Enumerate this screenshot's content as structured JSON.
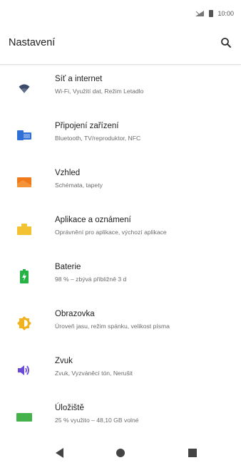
{
  "status": {
    "time": "10:00"
  },
  "header": {
    "title": "Nastavení"
  },
  "items": [
    {
      "title": "Síť a internet",
      "subtitle": "Wi-Fi, Využití dat, Režim Letadlo"
    },
    {
      "title": "Připojení zařízení",
      "subtitle": "Bluetooth, TV/reproduktor, NFC"
    },
    {
      "title": "Vzhled",
      "subtitle": "Schémata, tapety"
    },
    {
      "title": "Aplikace a oznámení",
      "subtitle": "Oprávnění pro aplikace, výchozí aplikace"
    },
    {
      "title": "Baterie",
      "subtitle": "98 % – zbývá přibližně 3 d"
    },
    {
      "title": "Obrazovka",
      "subtitle": "Úroveň jasu, režim spánku, velikost písma"
    },
    {
      "title": "Zvuk",
      "subtitle": "Zvuk, Vyzváněcí tón, Nerušit"
    },
    {
      "title": "Úložiště",
      "subtitle": "25 % využito – 48,10 GB volné"
    }
  ],
  "icons": {
    "wifi": "wifi-icon",
    "devices": "devices-icon",
    "appearance": "appearance-icon",
    "apps": "apps-icon",
    "battery": "battery-icon",
    "display": "display-icon",
    "sound": "sound-icon",
    "storage": "storage-icon"
  },
  "colors": {
    "wifi": "#3b4c6b",
    "devices": "#2f6fd6",
    "appearance": "#f07a1a",
    "apps": "#f2c233",
    "battery": "#27b245",
    "display": "#f2b21f",
    "sound": "#6a4bd8",
    "storage": "#43b24a"
  }
}
